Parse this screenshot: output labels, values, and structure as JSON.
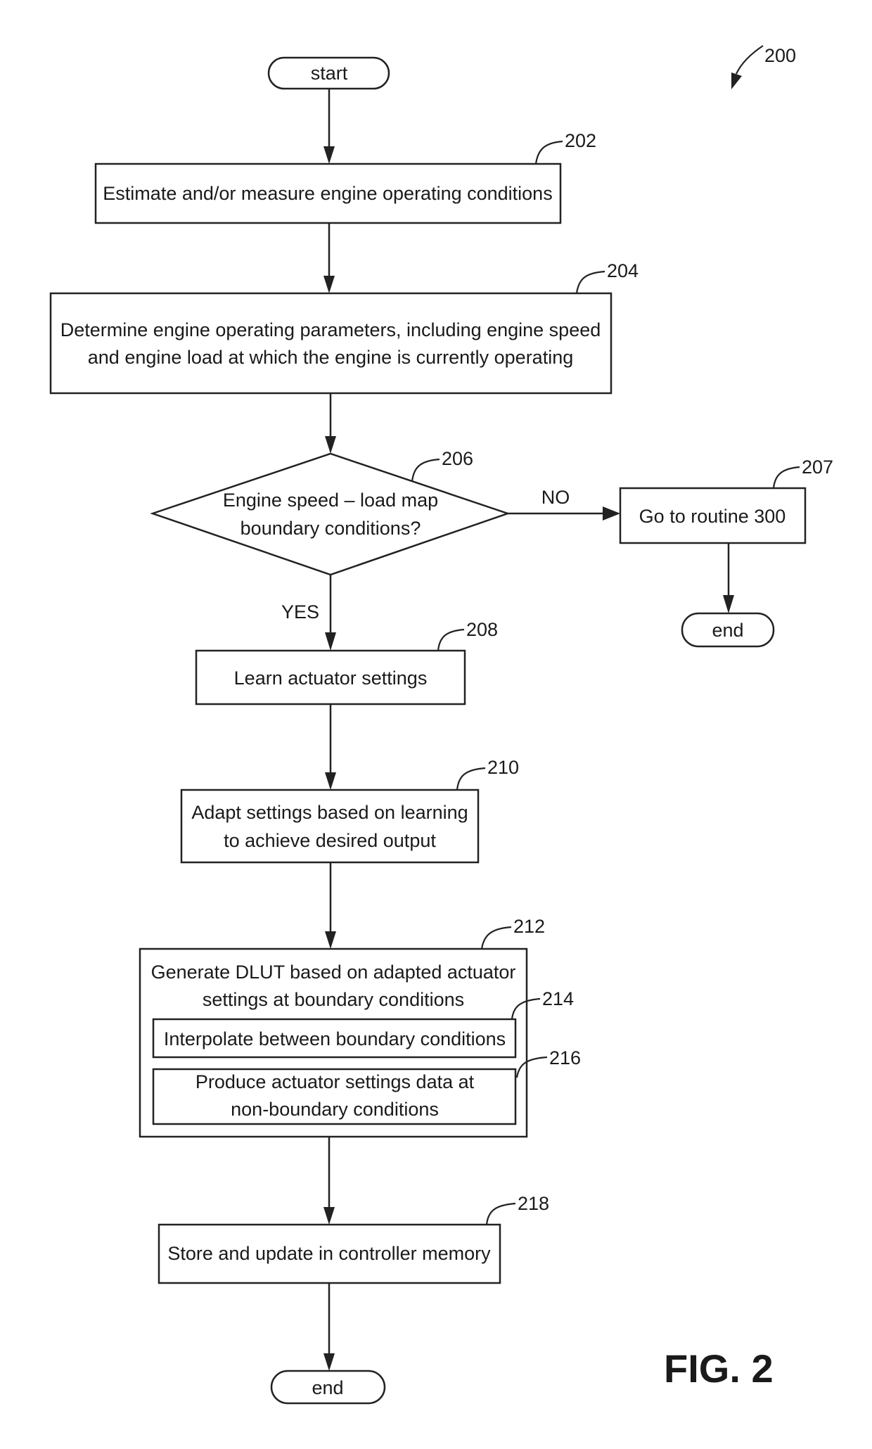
{
  "figure": {
    "label": "FIG. 2",
    "reference": "200"
  },
  "nodes": {
    "start": {
      "label": "start"
    },
    "n202": {
      "ref": "202",
      "lines": [
        "Estimate and/or measure engine operating conditions"
      ]
    },
    "n204": {
      "ref": "204",
      "lines": [
        "Determine engine operating parameters, including engine speed",
        "and engine load at which the engine is currently operating"
      ]
    },
    "n206": {
      "ref": "206",
      "lines": [
        "Engine speed – load map",
        "boundary conditions?"
      ]
    },
    "n207": {
      "ref": "207",
      "lines": [
        "Go to routine 300"
      ]
    },
    "end_right": {
      "label": "end"
    },
    "n208": {
      "ref": "208",
      "lines": [
        "Learn actuator settings"
      ]
    },
    "n210": {
      "ref": "210",
      "lines": [
        "Adapt settings based on learning",
        "to achieve desired output"
      ]
    },
    "n212": {
      "ref": "212",
      "lines": [
        "Generate DLUT based on adapted actuator",
        "settings at boundary conditions"
      ]
    },
    "n214": {
      "ref": "214",
      "lines": [
        "Interpolate between boundary conditions"
      ]
    },
    "n216": {
      "ref": "216",
      "lines": [
        "Produce actuator settings data at",
        "non-boundary conditions"
      ]
    },
    "n218": {
      "ref": "218",
      "lines": [
        "Store and update in controller memory"
      ]
    },
    "end_bottom": {
      "label": "end"
    }
  },
  "edges": {
    "no_label": "NO",
    "yes_label": "YES"
  }
}
